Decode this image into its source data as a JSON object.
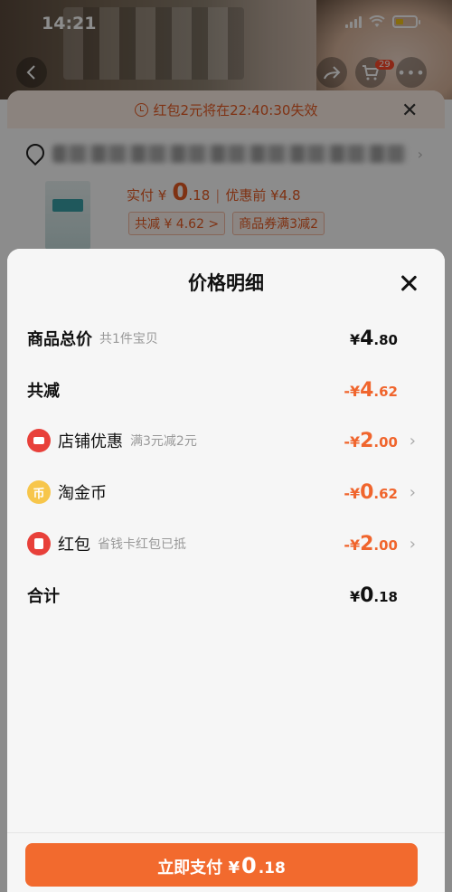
{
  "status_bar": {
    "time": "14:21"
  },
  "background": {
    "cart_count": "29",
    "coupon_notice": "红包2元将在22:40:30失效",
    "pay_label": "实付 ¥",
    "pay_int": "0",
    "pay_dec": ".18",
    "pre_discount": "优惠前 ¥4.8",
    "chip_total": "共减 ¥ 4.62 >",
    "chip_coupon": "商品券满3减2"
  },
  "sheet": {
    "title": "价格明细",
    "rows": [
      {
        "label": "商品总价",
        "sub": "共1件宝贝",
        "cur": "¥",
        "int": "4",
        "dec": ".80",
        "color": "#111111"
      },
      {
        "label": "共减",
        "sub": "",
        "cur": "-¥",
        "int": "4",
        "dec": ".62",
        "color": "#f0652d"
      },
      {
        "label": "店铺优惠",
        "sub": "满3元减2元",
        "cur": "-¥",
        "int": "2",
        "dec": ".00",
        "color": "#f0652d",
        "icon": "shop-icon"
      },
      {
        "label": "淘金币",
        "sub": "",
        "cur": "-¥",
        "int": "0",
        "dec": ".62",
        "color": "#f0652d",
        "icon": "coin-icon"
      },
      {
        "label": "红包",
        "sub": "省钱卡红包已抵",
        "cur": "-¥",
        "int": "2",
        "dec": ".00",
        "color": "#f0652d",
        "icon": "red-packet-icon"
      },
      {
        "label": "合计",
        "sub": "",
        "cur": "¥",
        "int": "0",
        "dec": ".18",
        "color": "#111111"
      }
    ],
    "coin_glyph": "币",
    "pay_button": {
      "label": "立即支付 ¥",
      "int": "0",
      "dec": ".18"
    }
  },
  "colors": {
    "accent": "#f26a2e",
    "discount": "#f0652d",
    "overlay": "rgba(0,0,0,0.45)"
  }
}
